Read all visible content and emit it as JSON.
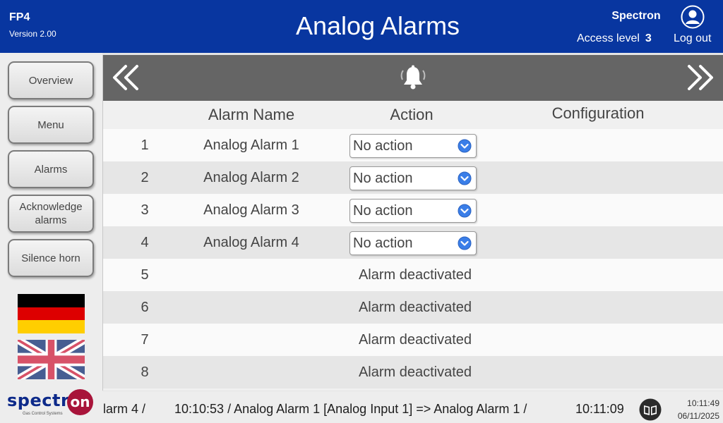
{
  "header": {
    "device": "FP4",
    "version": "Version 2.00",
    "title": "Analog Alarms",
    "company": "Spectron",
    "access_label": "Access level",
    "access_level": "3",
    "logout_label": "Log out"
  },
  "sidebar": {
    "buttons": [
      {
        "label": "Overview"
      },
      {
        "label": "Menu"
      },
      {
        "label": "Alarms"
      },
      {
        "label": "Acknowledge alarms"
      },
      {
        "label": "Silence horn"
      }
    ],
    "flags": [
      "german-flag",
      "uk-flag"
    ]
  },
  "table": {
    "headers": {
      "name": "Alarm Name",
      "action": "Action",
      "config": "Configuration"
    },
    "rows": [
      {
        "num": "1",
        "name": "Analog Alarm 1",
        "action": "No action"
      },
      {
        "num": "2",
        "name": "Analog Alarm 2",
        "action": "No action"
      },
      {
        "num": "3",
        "name": "Analog Alarm 3",
        "action": "No action"
      },
      {
        "num": "4",
        "name": "Analog Alarm 4",
        "action": "No action"
      },
      {
        "num": "5",
        "status": "Alarm deactivated"
      },
      {
        "num": "6",
        "status": "Alarm deactivated"
      },
      {
        "num": "7",
        "status": "Alarm deactivated"
      },
      {
        "num": "8",
        "status": "Alarm deactivated"
      }
    ]
  },
  "icons": {
    "nav_left": "double-chevron-left-icon",
    "nav_right": "double-chevron-right-icon",
    "bell": "bell-icon",
    "user": "user-icon",
    "dropdown": "chevron-down-circle-icon",
    "journal": "book-icon"
  },
  "footer": {
    "logo": "spectron",
    "logo_tagline": "Gas Control Systems",
    "ticker": [
      "larm 4 /",
      "10:10:53 / Analog Alarm 1 [Analog Input 1] => Analog Alarm 1 /",
      "10:11:09 /"
    ],
    "time": "10:11:49",
    "date": "06/11/2025"
  },
  "colors": {
    "header_bg": "#0836a0",
    "nav_bar": "#656565",
    "dropdown_icon": "#3a7ee8",
    "logo_blue": "#0d2a8a",
    "logo_red": "#a8143a"
  }
}
